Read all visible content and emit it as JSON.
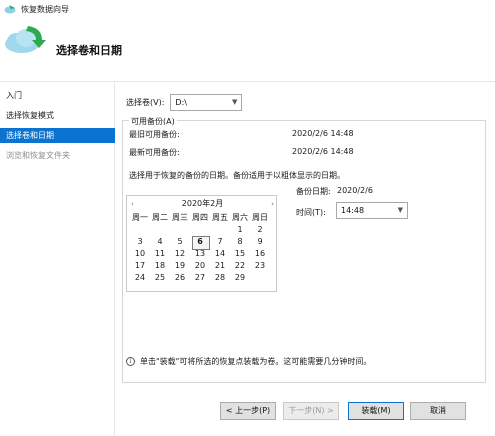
{
  "window": {
    "title": "恢复数据向导"
  },
  "header": {
    "title": "选择卷和日期"
  },
  "sidebar": {
    "items": [
      {
        "label": "入门"
      },
      {
        "label": "选择恢复模式"
      },
      {
        "label": "选择卷和日期"
      },
      {
        "label": "浏览和恢复文件夹"
      }
    ]
  },
  "volume": {
    "label": "选择卷(V):",
    "value": "D:\\"
  },
  "backups": {
    "legend": "可用备份(A)",
    "oldest_label": "最旧可用备份:",
    "oldest_value": "2020/2/6 14:48",
    "newest_label": "最新可用备份:",
    "newest_value": "2020/2/6 14:48",
    "instruction": "选择用于恢复的备份的日期。备份适用于以粗体显示的日期。"
  },
  "calendar": {
    "title": "2020年2月",
    "prev": "‹",
    "next": "›",
    "weekdays": [
      "周一",
      "周二",
      "周三",
      "周四",
      "周五",
      "周六",
      "周日"
    ],
    "selected_day": "6"
  },
  "backup_date": {
    "label": "备份日期:",
    "value": "2020/2/6"
  },
  "time": {
    "label": "时间(T):",
    "value": "14:48"
  },
  "info": "单击\"装载\"可将所选的恢复点装载为卷。这可能需要几分钟时间。",
  "buttons": {
    "back": "< 上一步(P)",
    "next": "下一步(N) >",
    "mount": "装载(M)",
    "cancel": "取消"
  },
  "colors": {
    "accent": "#0a74d0"
  },
  "icons": {
    "title": "recovery-icon",
    "header": "cloud-restore-icon"
  }
}
